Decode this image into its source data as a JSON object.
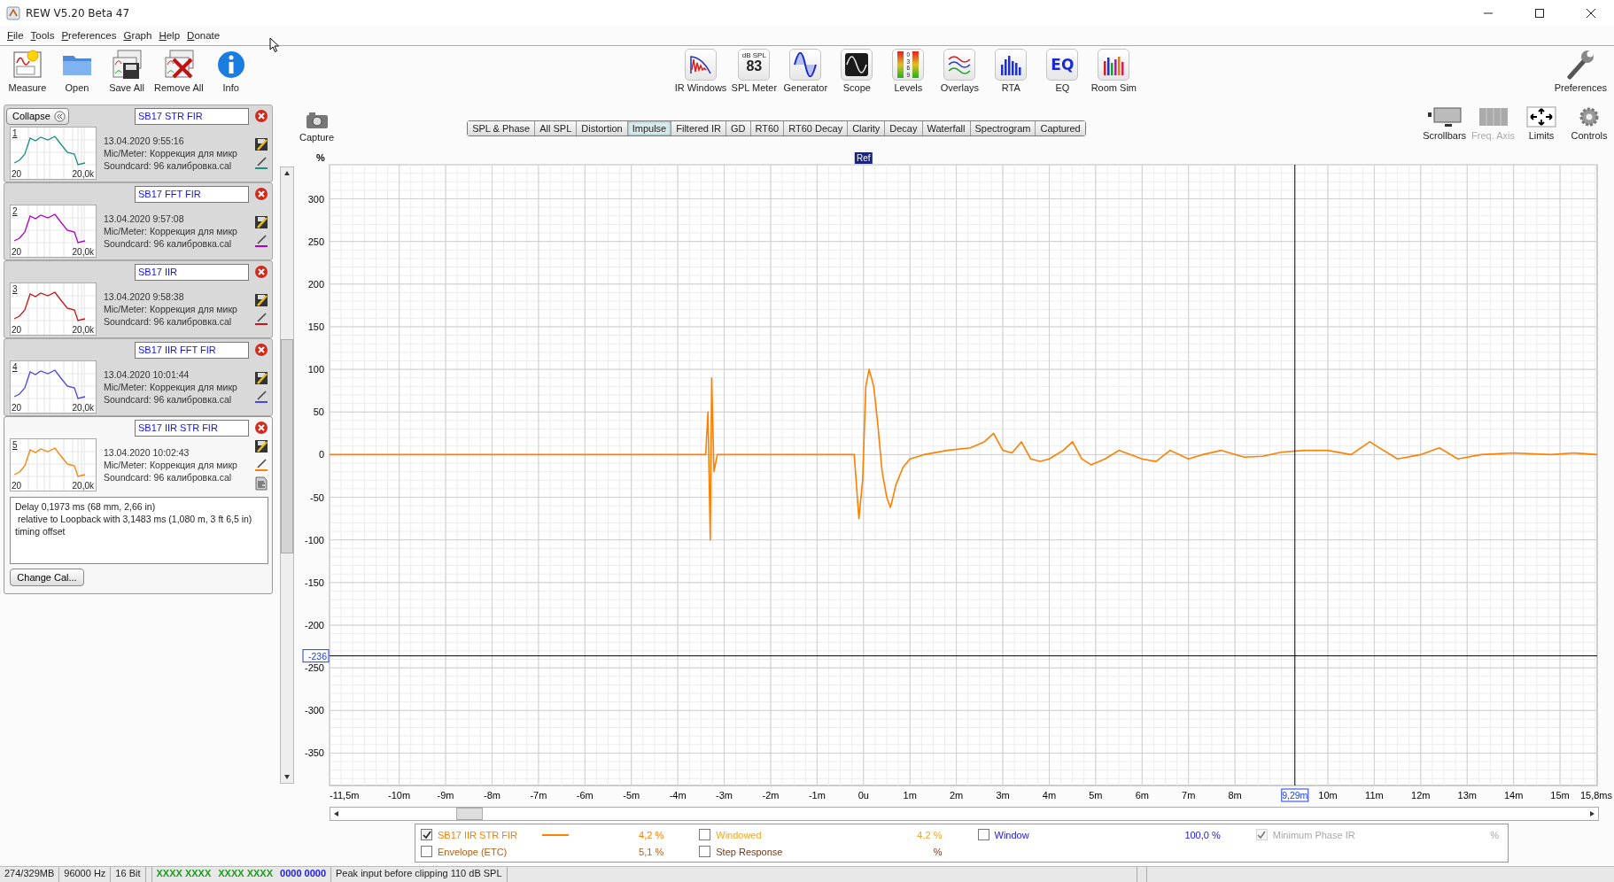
{
  "window": {
    "title": "REW V5.20 Beta 47"
  },
  "menu": [
    "File",
    "Tools",
    "Preferences",
    "Graph",
    "Help",
    "Donate"
  ],
  "toolbar": {
    "left": [
      {
        "label": "Measure"
      },
      {
        "label": "Open"
      },
      {
        "label": "Save All"
      },
      {
        "label": "Remove All"
      },
      {
        "label": "Info"
      }
    ],
    "center": [
      {
        "label": "IR Windows"
      },
      {
        "label": "SPL Meter",
        "icon_text": [
          "dB SPL",
          "83"
        ]
      },
      {
        "label": "Generator"
      },
      {
        "label": "Scope"
      },
      {
        "label": "Levels",
        "icon_text": [
          "0",
          "3",
          "6",
          "9"
        ]
      },
      {
        "label": "Overlays"
      },
      {
        "label": "RTA"
      },
      {
        "label": "EQ",
        "icon_text": [
          "EQ"
        ]
      },
      {
        "label": "Room Sim"
      }
    ],
    "right": [
      {
        "label": "Preferences"
      }
    ]
  },
  "panel": {
    "collapse_button": "Collapse",
    "measurements": [
      {
        "number": "1",
        "name": "SB17 STR FIR",
        "date": "13.04.2020 9:55:16",
        "mic": "Mic/Meter: Коррекция для микр",
        "soundcard": "Soundcard: 96 калибровка.cal",
        "axis_min": "20",
        "axis_max": "20,0k",
        "color": "#1a9080",
        "selected": false
      },
      {
        "number": "2",
        "name": "SB17 FFT FIR",
        "date": "13.04.2020 9:57:08",
        "mic": "Mic/Meter: Коррекция для микр",
        "soundcard": "Soundcard: 96 калибровка.cal",
        "axis_min": "20",
        "axis_max": "20,0k",
        "color": "#b000c8",
        "selected": false
      },
      {
        "number": "3",
        "name": "SB17 IIR",
        "date": "13.04.2020 9:58:38",
        "mic": "Mic/Meter: Коррекция для микр",
        "soundcard": "Soundcard: 96 калибровка.cal",
        "axis_min": "20",
        "axis_max": "20,0k",
        "color": "#c81414",
        "selected": false
      },
      {
        "number": "4",
        "name": "SB17 IIR FFT FIR",
        "date": "13.04.2020 10:01:44",
        "mic": "Mic/Meter: Коррекция для микр",
        "soundcard": "Soundcard: 96 калибровка.cal",
        "axis_min": "20",
        "axis_max": "20,0k",
        "color": "#4848e0",
        "selected": false
      },
      {
        "number": "5",
        "name": "SB17 IIR STR FIR",
        "date": "13.04.2020 10:02:43",
        "mic": "Mic/Meter: Коррекция для микр",
        "soundcard": "Soundcard: 96 калибровка.cal",
        "axis_min": "20",
        "axis_max": "20,0k",
        "color": "#ff8000",
        "selected": true
      }
    ],
    "delay_note": "Delay 0,1973 ms (68 mm, 2,66 in)\n relative to Loopback with 3,1483 ms (1,080 m, 3 ft 6,5 in)\ntiming offset",
    "change_cal_button": "Change Cal..."
  },
  "graph": {
    "capture": "Capture",
    "tabs": [
      {
        "label": "SPL & Phase",
        "selected": false
      },
      {
        "label": "All SPL",
        "selected": false
      },
      {
        "label": "Distortion",
        "selected": false
      },
      {
        "label": "Impulse",
        "selected": true
      },
      {
        "label": "Filtered IR",
        "selected": false
      },
      {
        "label": "GD",
        "selected": false
      },
      {
        "label": "RT60",
        "selected": false
      },
      {
        "label": "RT60 Decay",
        "selected": false
      },
      {
        "label": "Clarity",
        "selected": false
      },
      {
        "label": "Decay",
        "selected": false
      },
      {
        "label": "Waterfall",
        "selected": false
      },
      {
        "label": "Spectrogram",
        "selected": false
      },
      {
        "label": "Captured",
        "selected": false
      }
    ],
    "tools": [
      {
        "label": "Scrollbars",
        "disabled": false
      },
      {
        "label": "Freq. Axis",
        "disabled": true
      },
      {
        "label": "Limits",
        "disabled": false
      },
      {
        "label": "Controls",
        "disabled": false
      }
    ],
    "chart_data": {
      "type": "line",
      "ylabel": "%",
      "x": [
        -11.5,
        -8,
        -5,
        -3.4,
        -3.35,
        -3.3,
        -3.27,
        -3.22,
        -3.15,
        -2,
        -0.2,
        -0.1,
        -0.02,
        0.05,
        0.12,
        0.22,
        0.3,
        0.4,
        0.5,
        0.58,
        0.7,
        0.85,
        1.0,
        1.3,
        1.8,
        2.3,
        2.6,
        2.8,
        3.0,
        3.2,
        3.4,
        3.6,
        3.8,
        4.0,
        4.3,
        4.5,
        4.7,
        4.9,
        5.2,
        5.5,
        6.0,
        6.3,
        6.6,
        7.0,
        7.3,
        7.7,
        8.2,
        8.6,
        9.0,
        9.5,
        10.0,
        10.5,
        10.9,
        11.2,
        11.5,
        12.0,
        12.4,
        12.8,
        13.3,
        14.0,
        14.8,
        15.3,
        15.8
      ],
      "series": [
        {
          "name": "SB17 IIR STR FIR",
          "color": "#ff7f00",
          "values": [
            0,
            0,
            0,
            0,
            50,
            -100,
            90,
            -20,
            0,
            0,
            0,
            -75,
            -30,
            80,
            100,
            80,
            40,
            -20,
            -50,
            -62,
            -35,
            -15,
            -5,
            0,
            5,
            8,
            15,
            25,
            5,
            2,
            15,
            -5,
            -8,
            -5,
            5,
            15,
            -5,
            -12,
            -5,
            5,
            -5,
            -8,
            5,
            -5,
            0,
            5,
            -3,
            -2,
            3,
            5,
            5,
            0,
            15,
            5,
            -5,
            0,
            8,
            -5,
            0,
            2,
            0,
            2,
            0
          ]
        }
      ],
      "xlim": [
        -11.5,
        15.8
      ],
      "ylim": [
        -388,
        340
      ],
      "xticks": [
        {
          "value": -11.5,
          "label": "-11,5m"
        },
        {
          "value": -10,
          "label": "-10m"
        },
        {
          "value": -9,
          "label": "-9m"
        },
        {
          "value": -8,
          "label": "-8m"
        },
        {
          "value": -7,
          "label": "-7m"
        },
        {
          "value": -6,
          "label": "-6m"
        },
        {
          "value": -5,
          "label": "-5m"
        },
        {
          "value": -4,
          "label": "-4m"
        },
        {
          "value": -3,
          "label": "-3m"
        },
        {
          "value": -2,
          "label": "-2m"
        },
        {
          "value": -1,
          "label": "-1m"
        },
        {
          "value": 0,
          "label": "0u"
        },
        {
          "value": 1,
          "label": "1m"
        },
        {
          "value": 2,
          "label": "2m"
        },
        {
          "value": 3,
          "label": "3m"
        },
        {
          "value": 4,
          "label": "4m"
        },
        {
          "value": 5,
          "label": "5m"
        },
        {
          "value": 6,
          "label": "6m"
        },
        {
          "value": 7,
          "label": "7m"
        },
        {
          "value": 8,
          "label": "8m"
        },
        {
          "value": 10,
          "label": "10m"
        },
        {
          "value": 11,
          "label": "11m"
        },
        {
          "value": 12,
          "label": "12m"
        },
        {
          "value": 13,
          "label": "13m"
        },
        {
          "value": 14,
          "label": "14m"
        },
        {
          "value": 15,
          "label": "15m"
        },
        {
          "value": 15.8,
          "label": "15,8ms"
        }
      ],
      "yticks": [
        300,
        250,
        200,
        150,
        100,
        50,
        0,
        -50,
        -100,
        -150,
        -200,
        -250,
        -300,
        -350
      ],
      "grid": true,
      "annotations": [
        {
          "text": "Ref",
          "x": 0
        }
      ],
      "ref_lines": [
        {
          "axis": "x",
          "value": 9.29,
          "label": "9,29m"
        },
        {
          "axis": "y",
          "value": -236,
          "label": "-236"
        }
      ]
    }
  },
  "legend": [
    {
      "kind": "curve",
      "checked": true,
      "disabled": false,
      "color": "#ff7f00",
      "value": "4,2 %"
    },
    {
      "kind": "plain",
      "label": "Windowed",
      "checked": false,
      "disabled": false,
      "color": "#f5a623",
      "value": "4,2 %"
    },
    {
      "kind": "plain",
      "label": "Window",
      "checked": false,
      "disabled": false,
      "color": "#2020e0",
      "value": "100,0 %"
    },
    {
      "kind": "plain",
      "label": "Minimum Phase IR",
      "checked": true,
      "disabled": true,
      "color": "#a8a8a8",
      "value": "%"
    },
    {
      "kind": "plain",
      "label": "Envelope (ETC)",
      "checked": false,
      "disabled": false,
      "color": "#b0601a",
      "value": "5,1 %"
    },
    {
      "kind": "plain",
      "label": "Step Response",
      "checked": false,
      "disabled": false,
      "color": "#6b3a1e",
      "value": "%"
    }
  ],
  "status_bar": {
    "cells": [
      "274/329MB",
      "96000 Hz",
      "16 Bit",
      "Peak input before clipping 110 dB SPL"
    ],
    "meters": [
      {
        "text": "XXXX XXXX",
        "color": "#1e9a1e"
      },
      {
        "text": "XXXX XXXX",
        "color": "#1e9a1e"
      },
      {
        "text": "0000 0000",
        "color": "#2020e0"
      }
    ]
  }
}
